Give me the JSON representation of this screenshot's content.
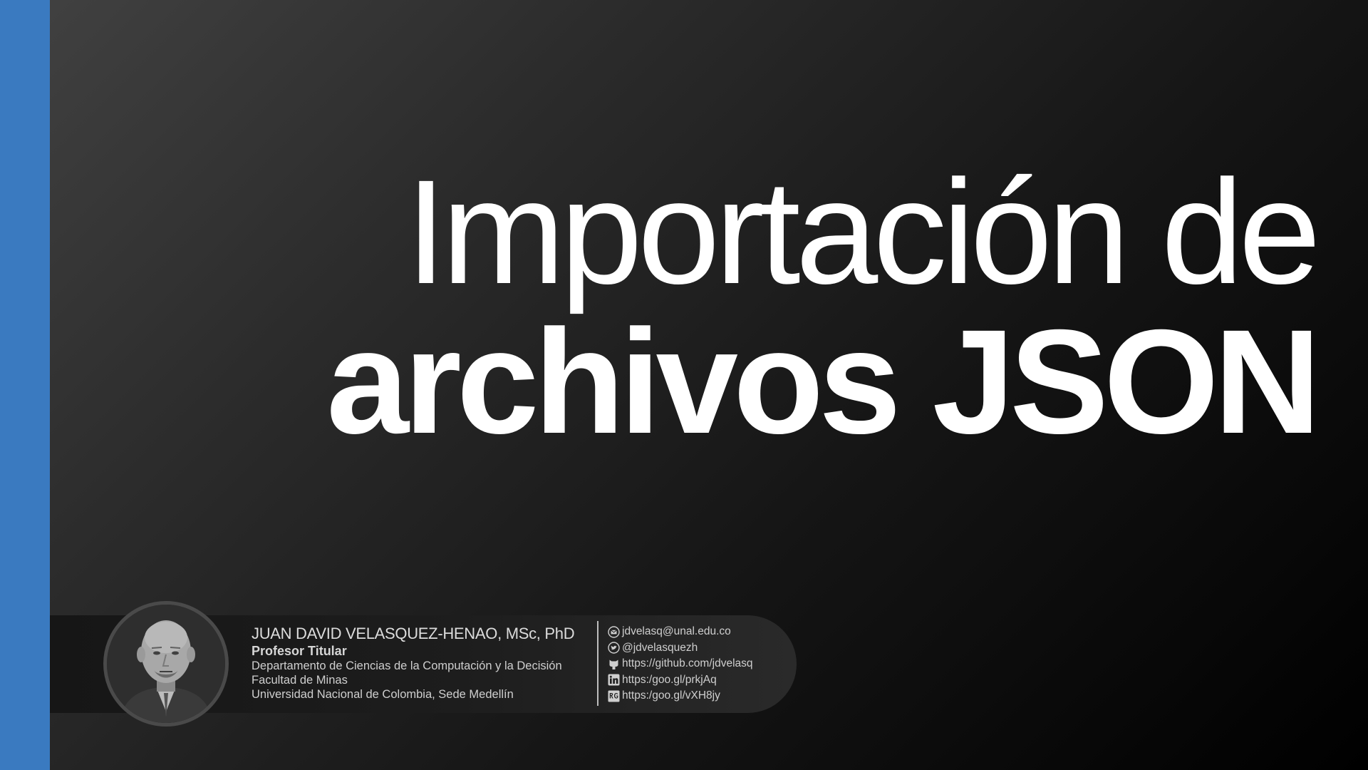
{
  "slide": {
    "title_line1": "Importación de",
    "title_line2": "archivos JSON",
    "accent_color": "#3a7ac0"
  },
  "author": {
    "name": "JUAN DAVID VELASQUEZ-HENAO, MSc, PhD",
    "role": "Profesor Titular",
    "department": "Departamento de Ciencias de la Computación y la Decisión",
    "faculty": "Facultad de Minas",
    "university": "Universidad Nacional de Colombia, Sede Medellín"
  },
  "contacts": [
    {
      "icon": "email-icon",
      "text": "jdvelasq@unal.edu.co"
    },
    {
      "icon": "twitter-icon",
      "text": "@jdvelasquezh"
    },
    {
      "icon": "github-icon",
      "text": "https://github.com/jdvelasq"
    },
    {
      "icon": "linkedin-icon",
      "text": "https:/goo.gl/prkjAq"
    },
    {
      "icon": "researchgate-icon",
      "text": "https:/goo.gl/vXH8jy"
    }
  ]
}
